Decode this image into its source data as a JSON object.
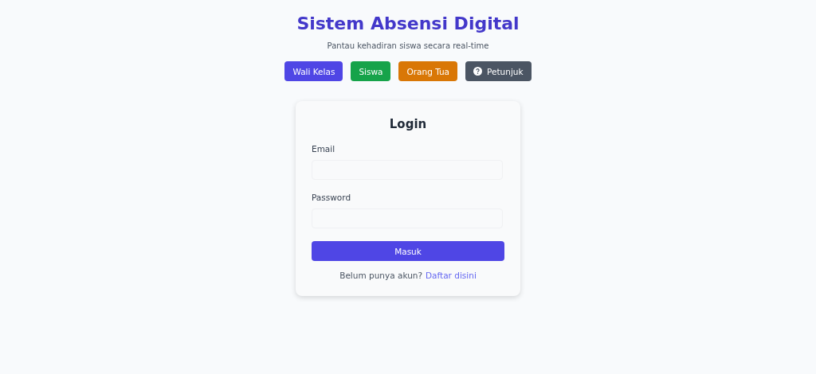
{
  "header": {
    "title": "Sistem Absensi Digital",
    "subtitle": "Pantau kehadiran siswa secara real-time"
  },
  "role_buttons": [
    {
      "label": "Wali Kelas",
      "color": "#4f46e5",
      "kind": "role"
    },
    {
      "label": "Siswa",
      "color": "#16a34a",
      "kind": "role"
    },
    {
      "label": "Orang Tua",
      "color": "#d97706",
      "kind": "role"
    },
    {
      "label": "Petunjuk",
      "color": "#4b5563",
      "kind": "help"
    }
  ],
  "login": {
    "title": "Login",
    "fields": [
      {
        "label": "Email"
      },
      {
        "label": "Password"
      }
    ],
    "submit": "Masuk",
    "footer_text": "Belum punya akun?",
    "footer_link": "Daftar disini"
  }
}
